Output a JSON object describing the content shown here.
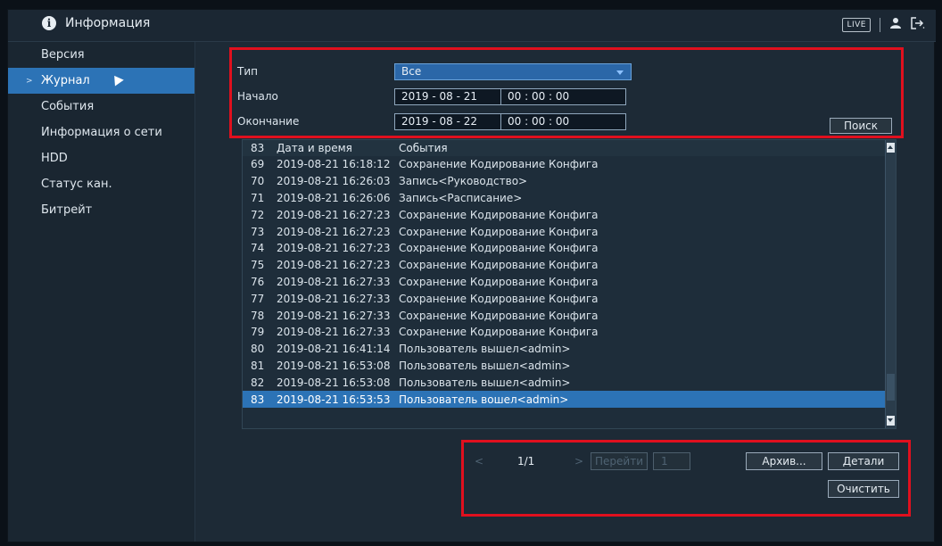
{
  "header": {
    "title": "Информация",
    "live_label": "LIVE",
    "user_icon": "user-icon",
    "logout_icon": "logout-icon"
  },
  "sidebar": {
    "items": [
      {
        "label": "Версия"
      },
      {
        "label": "Журнал",
        "active": true
      },
      {
        "label": "События"
      },
      {
        "label": "Информация о сети"
      },
      {
        "label": "HDD"
      },
      {
        "label": "Статус кан."
      },
      {
        "label": "Битрейт"
      }
    ]
  },
  "filter": {
    "type_label": "Тип",
    "type_value": "Все",
    "start_label": "Начало",
    "start_date": "2019 - 08 - 21",
    "start_time": "00 : 00 : 00",
    "end_label": "Окончание",
    "end_date": "2019 - 08 - 22",
    "end_time": "00 : 00 : 00",
    "search_label": "Поиск"
  },
  "log_table": {
    "header": {
      "no": "83",
      "time": "Дата и время",
      "event": "События"
    },
    "rows": [
      {
        "no": "69",
        "time": "2019-08-21 16:18:12",
        "event": "Сохранение Кодирование Конфига"
      },
      {
        "no": "70",
        "time": "2019-08-21 16:26:03",
        "event": "Запись<Руководство>"
      },
      {
        "no": "71",
        "time": "2019-08-21 16:26:06",
        "event": "Запись<Расписание>"
      },
      {
        "no": "72",
        "time": "2019-08-21 16:27:23",
        "event": "Сохранение Кодирование Конфига"
      },
      {
        "no": "73",
        "time": "2019-08-21 16:27:23",
        "event": "Сохранение Кодирование Конфига"
      },
      {
        "no": "74",
        "time": "2019-08-21 16:27:23",
        "event": "Сохранение Кодирование Конфига"
      },
      {
        "no": "75",
        "time": "2019-08-21 16:27:23",
        "event": "Сохранение Кодирование Конфига"
      },
      {
        "no": "76",
        "time": "2019-08-21 16:27:33",
        "event": "Сохранение Кодирование Конфига"
      },
      {
        "no": "77",
        "time": "2019-08-21 16:27:33",
        "event": "Сохранение Кодирование Конфига"
      },
      {
        "no": "78",
        "time": "2019-08-21 16:27:33",
        "event": "Сохранение Кодирование Конфига"
      },
      {
        "no": "79",
        "time": "2019-08-21 16:27:33",
        "event": "Сохранение Кодирование Конфига"
      },
      {
        "no": "80",
        "time": "2019-08-21 16:41:14",
        "event": "Пользователь вышел<admin>"
      },
      {
        "no": "81",
        "time": "2019-08-21 16:53:08",
        "event": "Пользователь вышел<admin>"
      },
      {
        "no": "82",
        "time": "2019-08-21 16:53:08",
        "event": "Пользователь вышел<admin>"
      },
      {
        "no": "83",
        "time": "2019-08-21 16:53:53",
        "event": "Пользователь вошел<admin>",
        "selected": true
      }
    ]
  },
  "pager": {
    "prev": "<",
    "page": "1/1",
    "next": ">",
    "goto_label": "Перейти",
    "goto_value": "1",
    "archive_label": "Архив...",
    "details_label": "Детали",
    "clear_label": "Очистить"
  }
}
